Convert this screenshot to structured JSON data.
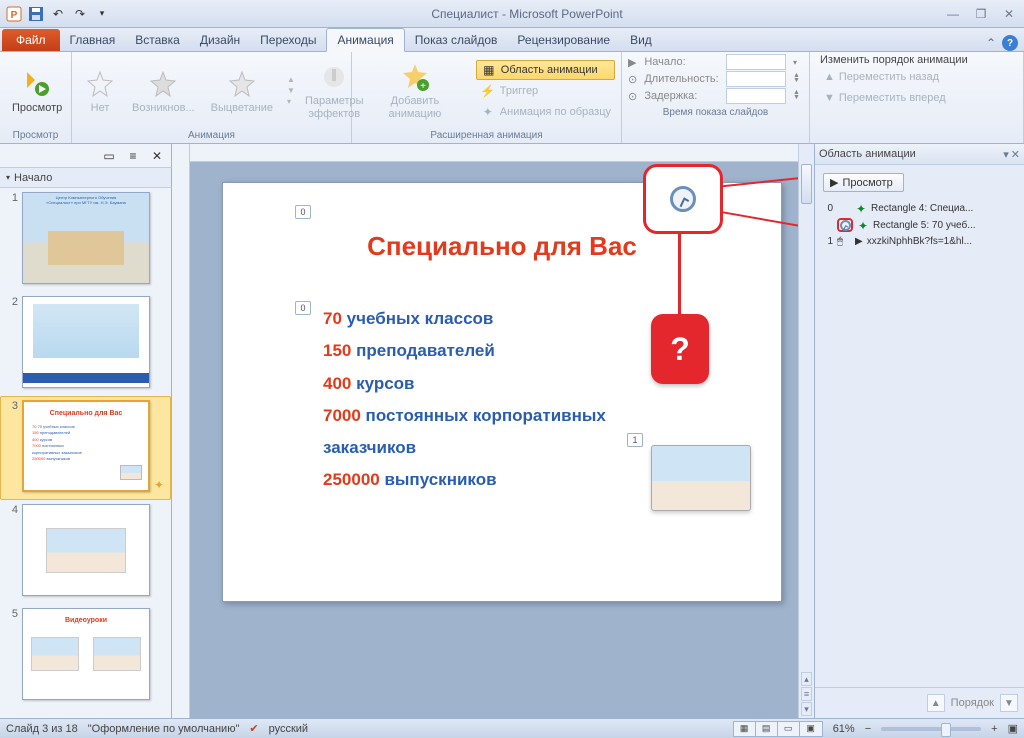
{
  "window": {
    "title": "Специалист - Microsoft PowerPoint"
  },
  "tabs": {
    "file": "Файл",
    "list": [
      "Главная",
      "Вставка",
      "Дизайн",
      "Переходы",
      "Анимация",
      "Показ слайдов",
      "Рецензирование",
      "Вид"
    ],
    "active_index": 4
  },
  "ribbon": {
    "preview": {
      "label": "Просмотр",
      "group": "Просмотр"
    },
    "anim_group": "Анимация",
    "effects": {
      "none": "Нет",
      "appear": "Возникнов...",
      "fade": "Выцветание"
    },
    "effect_params": "Параметры эффектов",
    "ext_group": "Расширенная анимация",
    "add_anim": "Добавить анимацию",
    "pane_btn": "Область анимации",
    "trigger_btn": "Триггер",
    "painter_btn": "Анимация по образцу",
    "timing": {
      "start": "Начало:",
      "duration": "Длительность:",
      "delay": "Задержка:",
      "group": "Время показа слайдов"
    },
    "reorder": {
      "title": "Изменить порядок анимации",
      "back": "Переместить назад",
      "fwd": "Переместить вперед"
    }
  },
  "outline": {
    "section": "Начало"
  },
  "thumbs": [
    {
      "n": "1"
    },
    {
      "n": "2"
    },
    {
      "n": "3"
    },
    {
      "n": "4"
    },
    {
      "n": "5"
    }
  ],
  "thumb3": {
    "title": "Специально для Вас",
    "lines": [
      "70 учебных классов",
      "150 преподавателей",
      "400 курсов",
      "7000 постоянных",
      "корпоративных заказчиков",
      "250000 выпускников"
    ]
  },
  "thumb5": {
    "title": "Видеоуроки"
  },
  "slide": {
    "title": "Специально для Вас",
    "bullets": [
      {
        "n": "70",
        "t": " учебных классов"
      },
      {
        "n": "150",
        "t": " преподавателей"
      },
      {
        "n": "400",
        "t": " курсов"
      },
      {
        "n": "7000",
        "t": " постоянных корпоративных заказчиков"
      },
      {
        "n": "250000",
        "t": " выпускников"
      }
    ],
    "tag0": "0",
    "tag1": "0",
    "tag2": "1"
  },
  "callout": {
    "q": "?"
  },
  "anim_pane": {
    "title": "Область анимации",
    "play": "Просмотр",
    "items": [
      {
        "idx": "0",
        "label": "Rectangle 4: Специа..."
      },
      {
        "idx": "",
        "label": "Rectangle 5: 70 учеб..."
      },
      {
        "idx": "1",
        "label": "xxzkiNphhBk?fs=1&hl..."
      }
    ],
    "order": "Порядок"
  },
  "status": {
    "slide": "Слайд 3 из 18",
    "theme": "\"Оформление по умолчанию\"",
    "lang": "русский",
    "zoom": "61%"
  }
}
